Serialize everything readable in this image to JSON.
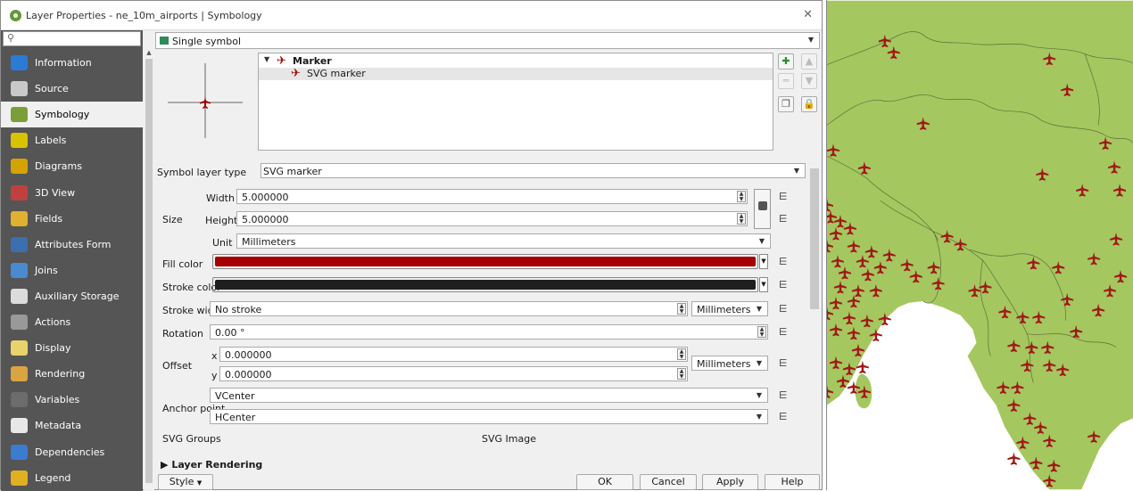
{
  "window": {
    "title": "Layer Properties - ne_10m_airports | Symbology",
    "close_glyph": "✕"
  },
  "sidebar": {
    "search_placeholder": "",
    "items": [
      {
        "label": "Information",
        "icon": "information-icon",
        "color": "#2b7bd4"
      },
      {
        "label": "Source",
        "icon": "source-icon",
        "color": "#c9c9c9"
      },
      {
        "label": "Symbology",
        "icon": "symbology-icon",
        "color": "#7a9e3a",
        "selected": true
      },
      {
        "label": "Labels",
        "icon": "labels-icon",
        "color": "#d9c300"
      },
      {
        "label": "Diagrams",
        "icon": "diagrams-icon",
        "color": "#d4a300"
      },
      {
        "label": "3D View",
        "icon": "3d-view-icon",
        "color": "#c04040"
      },
      {
        "label": "Fields",
        "icon": "fields-icon",
        "color": "#e0b030"
      },
      {
        "label": "Attributes Form",
        "icon": "attributes-form-icon",
        "color": "#3c6fb0"
      },
      {
        "label": "Joins",
        "icon": "joins-icon",
        "color": "#4a8ad0"
      },
      {
        "label": "Auxiliary Storage",
        "icon": "auxiliary-storage-icon",
        "color": "#dcdcdc"
      },
      {
        "label": "Actions",
        "icon": "actions-icon",
        "color": "#999999"
      },
      {
        "label": "Display",
        "icon": "display-icon",
        "color": "#e8d36a"
      },
      {
        "label": "Rendering",
        "icon": "rendering-icon",
        "color": "#d9a441"
      },
      {
        "label": "Variables",
        "icon": "variables-icon",
        "color": "#6c6c6c"
      },
      {
        "label": "Metadata",
        "icon": "metadata-icon",
        "color": "#e8e8e8"
      },
      {
        "label": "Dependencies",
        "icon": "dependencies-icon",
        "color": "#3a7ccf"
      },
      {
        "label": "Legend",
        "icon": "legend-icon",
        "color": "#e0b020"
      }
    ]
  },
  "renderer": {
    "label": "Single symbol"
  },
  "symbol_tree": {
    "root": "Marker",
    "child": "SVG marker",
    "expand_glyph": "▼"
  },
  "properties": {
    "symbol_layer_type_label": "Symbol layer type",
    "symbol_layer_type_value": "SVG marker",
    "size_label": "Size",
    "width_label": "Width",
    "width_value": "5.000000",
    "height_label": "Height",
    "height_value": "5.000000",
    "unit_label": "Unit",
    "unit_value": "Millimeters",
    "fill_color_label": "Fill color",
    "fill_color": "#a50000",
    "stroke_color_label": "Stroke color",
    "stroke_color": "#1e1e1e",
    "stroke_width_label": "Stroke width",
    "stroke_width_value": "No stroke",
    "stroke_width_unit": "Millimeters",
    "rotation_label": "Rotation",
    "rotation_value": "0.00 °",
    "offset_label": "Offset",
    "offset_x_label": "x",
    "offset_x_value": "0.000000",
    "offset_y_label": "y",
    "offset_y_value": "0.000000",
    "offset_unit": "Millimeters",
    "anchor_label": "Anchor point",
    "anchor_v": "VCenter",
    "anchor_h": "HCenter",
    "svg_groups_label": "SVG Groups",
    "svg_image_label": "SVG Image"
  },
  "layer_rendering": {
    "label": "Layer Rendering"
  },
  "footer": {
    "style_label": "Style",
    "ok": "OK",
    "cancel": "Cancel",
    "apply": "Apply",
    "help": "Help"
  },
  "map": {
    "land_color": "#a5c75f",
    "marker_color": "#a01818",
    "marker_glyph": "✈"
  }
}
